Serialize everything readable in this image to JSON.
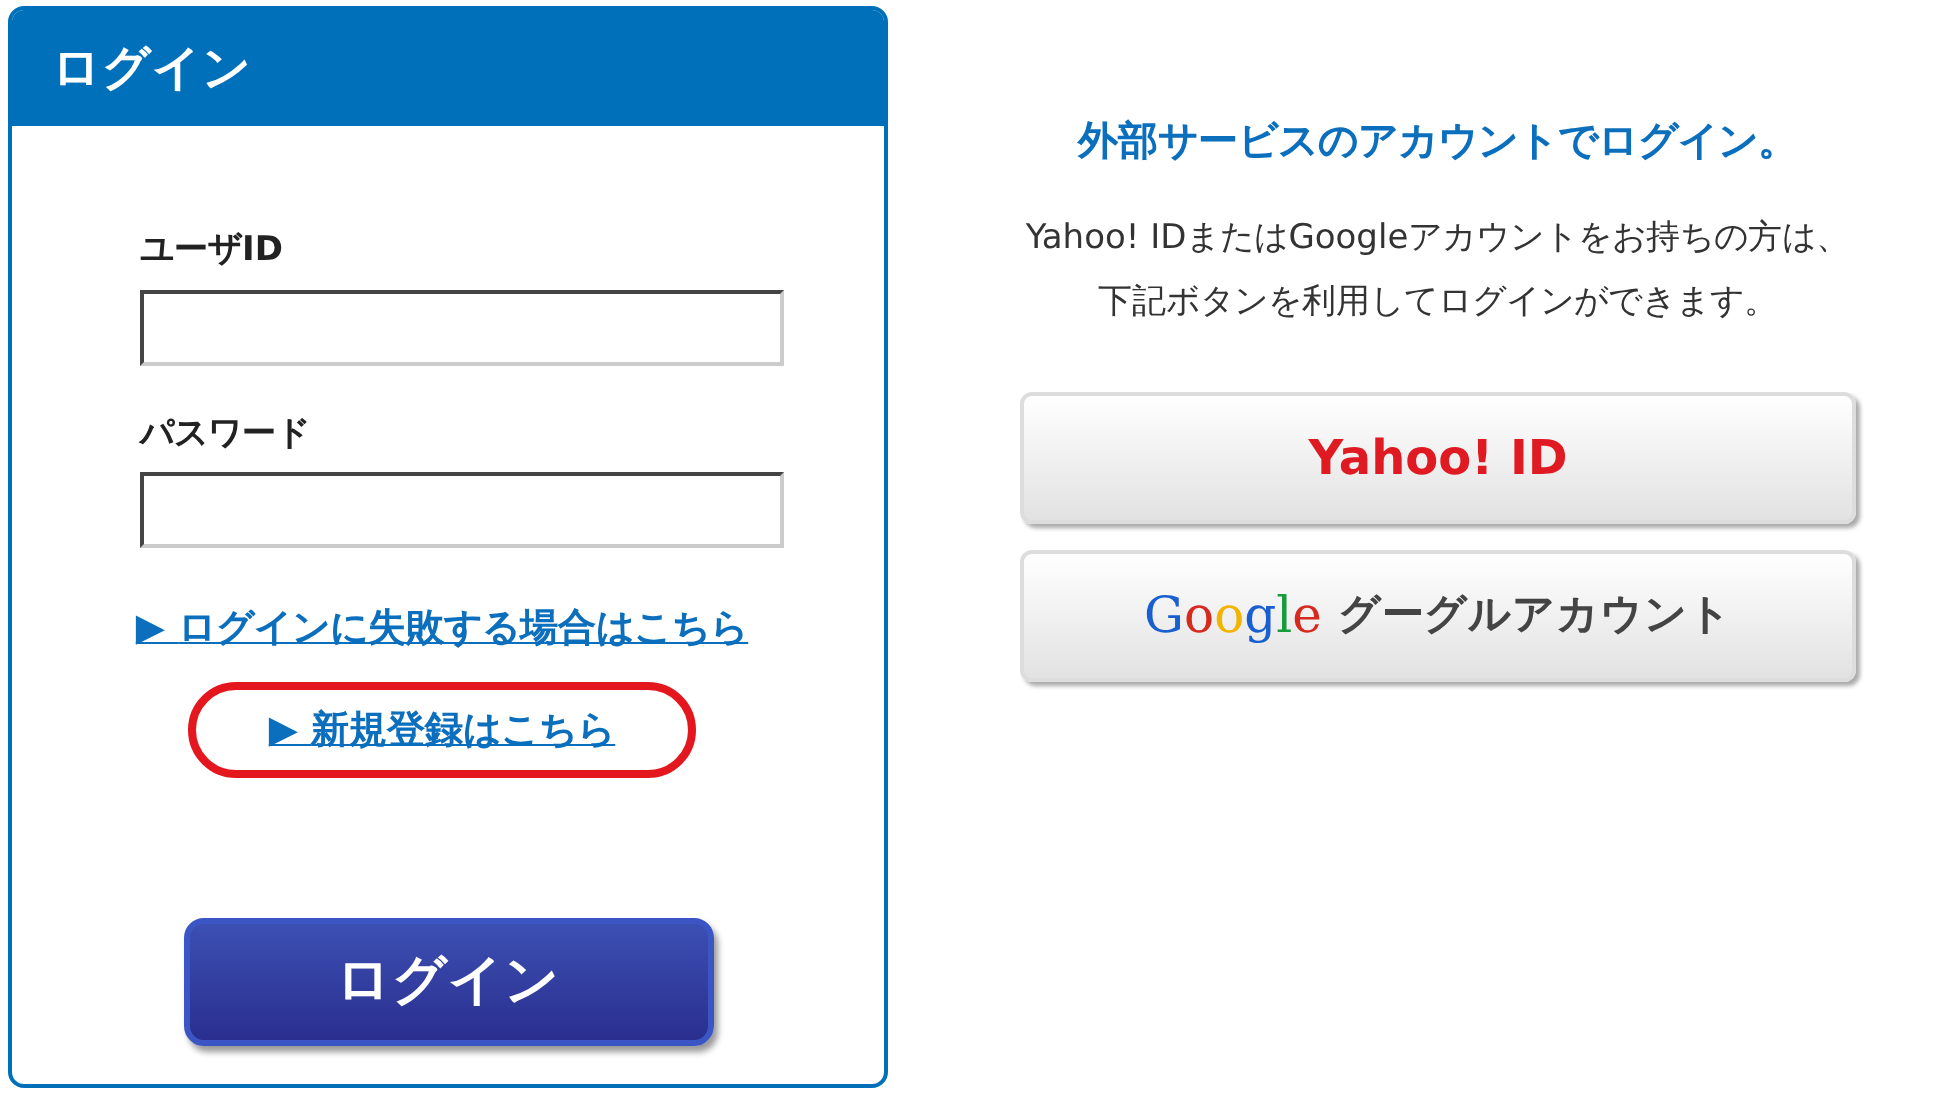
{
  "login_panel": {
    "title": "ログイン",
    "fields": [
      {
        "label": "ユーザID"
      },
      {
        "label": "パスワード"
      }
    ],
    "links": [
      {
        "icon": "▶",
        "text": "ログインに失敗する場合はこちら",
        "highlighted": false
      },
      {
        "icon": "▶",
        "text": "新規登録はこちら",
        "highlighted": true
      }
    ],
    "submit": "ログイン"
  },
  "external": {
    "heading": "外部サービスのアカウントでログイン。",
    "description": [
      "Yahoo! IDまたはGoogleアカウントをお持ちの方は、",
      "下記ボタンを利用してログインができます。"
    ],
    "buttons": [
      {
        "kind": "yahoo",
        "label": "Yahoo! ID"
      },
      {
        "kind": "google",
        "logo": "Google",
        "label": "グーグルアカウント"
      }
    ]
  }
}
